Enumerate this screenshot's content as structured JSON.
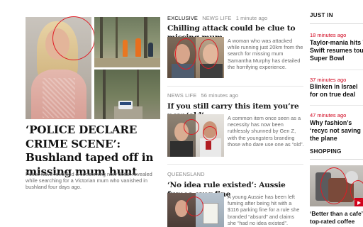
{
  "colors": {
    "accent_red": "#d0021b",
    "ring_red": "#e01b24",
    "headline_black": "#111111",
    "meta_gray": "#8a8a8a",
    "body_gray": "#6a6a6a"
  },
  "lead": {
    "headline": "‘POLICE DECLARE CRIME SCENE’: Bushland taped off in missing mum hunt",
    "standfirst": "Police have revealed a concerning new detail revealed while searching for a Victorian mum who vanished in bushland four days ago."
  },
  "middle": {
    "stories": [
      {
        "label": "EXCLUSIVE",
        "category": "NEWS LIFE",
        "time": "1 minute ago",
        "title": "Chilling attack could be clue to missing mum",
        "summary": "A woman who was attacked while running just 20km from the search for missing mum Samantha Murphy has detailed the horrifying experience."
      },
      {
        "label": "",
        "category": "NEWS LIFE",
        "time": "56 minutes ago",
        "title": "If you still carry this item you’re now ‘old’",
        "summary": "A common item once seen as a necessity has now been ruthlessly shunned by Gen Z, with the youngsters branding those who dare use one as “old”."
      },
      {
        "label": "",
        "category": "QUEENSLAND",
        "time": "",
        "title": "‘No idea rule existed’: Aussie fumes over fine",
        "summary": "A young Aussie has been left fuming after being hit with a $116 parking fine for a rule she branded “absurd” and claims she “had no idea existed”."
      }
    ]
  },
  "just_in": {
    "heading": "JUST IN",
    "items": [
      {
        "time": "18 minutes ago",
        "title": "Taylor-mania hits To Swift resumes tour Super Bowl"
      },
      {
        "time": "37 minutes ago",
        "title": "Blinken in Israel for on true deal"
      },
      {
        "time": "47 minutes ago",
        "title": "Why fashion’s ‘recyc not saving the plane"
      }
    ]
  },
  "shopping": {
    "heading": "SHOPPING",
    "title": "‘Better than a cafe’: top-rated coffee mac"
  },
  "icons": [
    "play-icon"
  ]
}
